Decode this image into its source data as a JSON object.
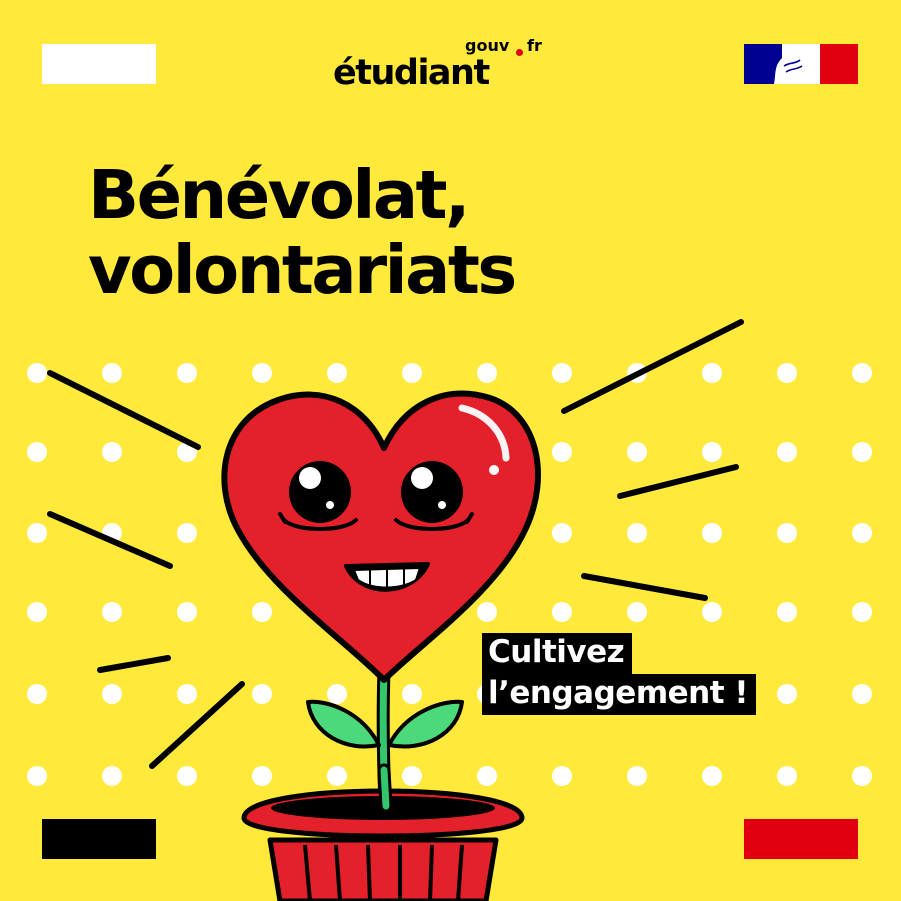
{
  "logo": {
    "main": "étudiant",
    "gouv": "gouv",
    "fr": "fr"
  },
  "title": {
    "line1": "Bénévolat,",
    "line2": "volontariats"
  },
  "tagline": {
    "line1": "Cultivez",
    "line2": "l’engagement !"
  },
  "colors": {
    "background": "#FFE93B",
    "black": "#000000",
    "white": "#FFFFFF",
    "republic_blue": "#000091",
    "republic_red": "#E1000F",
    "heart_red": "#E4202A",
    "leaf_green": "#4CD97B",
    "stem_green": "#33C66A"
  },
  "icons": {
    "heart_plant": "heart-plant-illustration",
    "marianne": "marianne-flag-logo"
  }
}
